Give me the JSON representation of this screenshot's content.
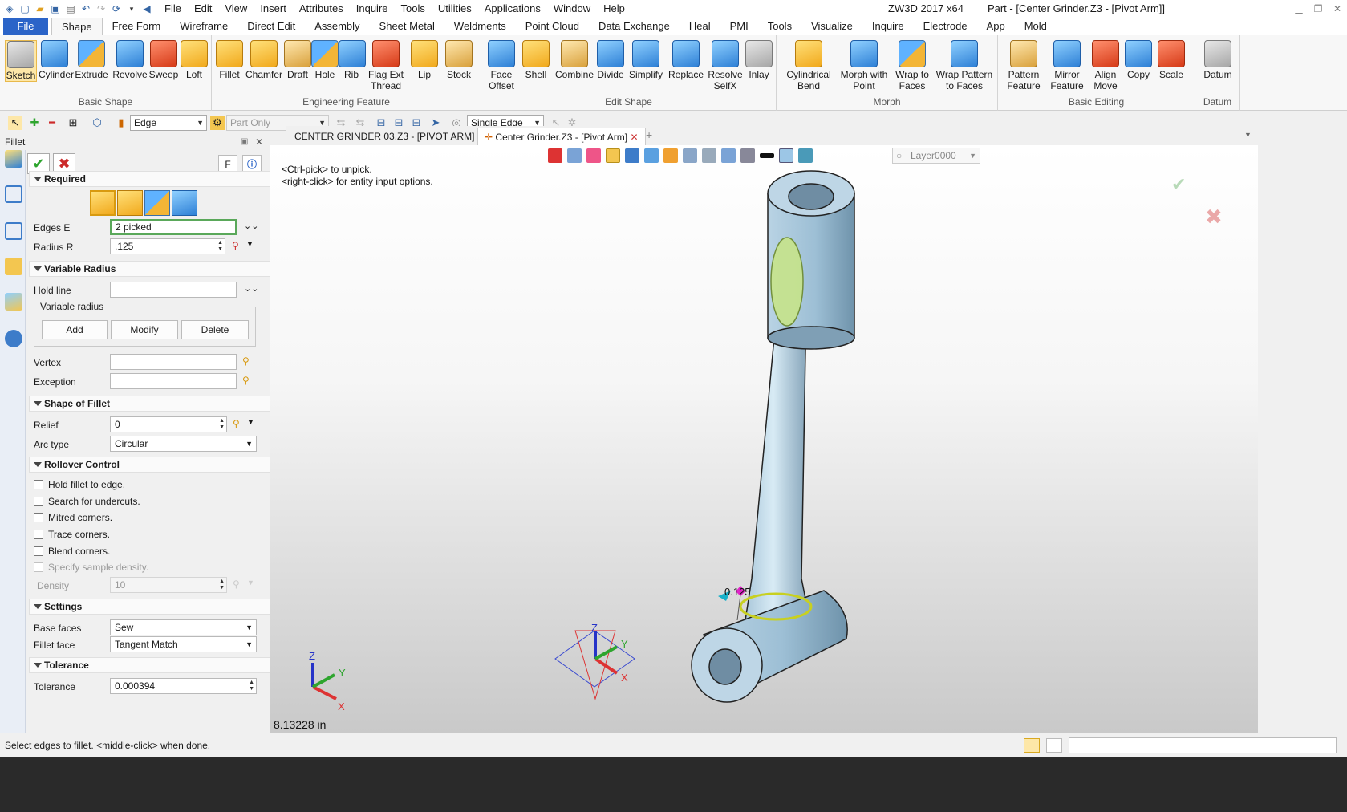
{
  "titlebar": {
    "menu": [
      "File",
      "Edit",
      "View",
      "Insert",
      "Attributes",
      "Inquire",
      "Tools",
      "Utilities",
      "Applications",
      "Window",
      "Help"
    ],
    "app_name": "ZW3D 2017  x64",
    "doc_title": "Part - [Center Grinder.Z3 - [Pivot Arm]]"
  },
  "ribbon_tabs": [
    "File",
    "Shape",
    "Free Form",
    "Wireframe",
    "Direct Edit",
    "Assembly",
    "Sheet Metal",
    "Weldments",
    "Point Cloud",
    "Data Exchange",
    "Heal",
    "PMI",
    "Tools",
    "Visualize",
    "Inquire",
    "Electrode",
    "App",
    "Mold"
  ],
  "ribbon_groups": {
    "basic_shape": {
      "label": "Basic Shape",
      "buttons": [
        "Sketch",
        "Cylinder",
        "Extrude",
        "Revolve",
        "Sweep",
        "Loft"
      ]
    },
    "engineering": {
      "label": "Engineering Feature",
      "buttons": [
        "Fillet",
        "Chamfer",
        "Draft",
        "Hole",
        "Rib",
        "Flag Ext\nThread",
        "Lip",
        "Stock"
      ]
    },
    "edit_shape": {
      "label": "Edit Shape",
      "buttons": [
        "Face\nOffset",
        "Shell",
        "Combine",
        "Divide",
        "Simplify",
        "Replace",
        "Resolve\nSelfX",
        "Inlay"
      ]
    },
    "morph": {
      "label": "Morph",
      "buttons": [
        "Cylindrical\nBend",
        "Morph with\nPoint",
        "Wrap to\nFaces",
        "Wrap Pattern\nto Faces"
      ]
    },
    "basic_editing": {
      "label": "Basic Editing",
      "buttons": [
        "Pattern\nFeature",
        "Mirror\nFeature",
        "Align\nMove",
        "Copy",
        "Scale"
      ]
    },
    "datum": {
      "label": "Datum",
      "buttons": [
        "Datum"
      ]
    }
  },
  "toolbar2": {
    "filter": "Edge",
    "scope": "Part Only",
    "pick_mode": "Single Edge"
  },
  "panel": {
    "title": "Fillet",
    "f_button": "F",
    "sections": {
      "required": "Required",
      "variable_radius": "Variable Radius",
      "shape": "Shape of Fillet",
      "rollover": "Rollover Control",
      "settings": "Settings",
      "tolerance": "Tolerance"
    },
    "edges_label": "Edges E",
    "edges_value": "2 picked",
    "radius_label": "Radius R",
    "radius_value": ".125",
    "hold_line_label": "Hold line",
    "variable_radius_group": "Variable radius",
    "add": "Add",
    "modify": "Modify",
    "delete": "Delete",
    "vertex_label": "Vertex",
    "exception_label": "Exception",
    "relief_label": "Relief",
    "relief_value": "0",
    "arc_type_label": "Arc type",
    "arc_type_value": "Circular",
    "rollover_options": [
      "Hold fillet to edge.",
      "Search for undercuts.",
      "Mitred corners.",
      "Trace corners.",
      "Blend corners."
    ],
    "sample_density": "Specify sample density.",
    "density_label": "Density",
    "density_value": "10",
    "base_faces_label": "Base faces",
    "base_faces_value": "Sew",
    "fillet_face_label": "Fillet face",
    "fillet_face_value": "Tangent Match",
    "tolerance_label": "Tolerance",
    "tolerance_value": "0.000394"
  },
  "doc_tabs": [
    "CENTER GRINDER 03.Z3 - [PIVOT ARM]",
    "Center Grinder.Z3 - [Pivot Arm]"
  ],
  "viewport": {
    "hint1": "<Ctrl-pick> to unpick.",
    "hint2": "<right-click> for entity input options.",
    "layer": "Layer0000",
    "radius_tag": "0.125",
    "scale_readout": "8.13228 in",
    "axis_labels": {
      "x": "X",
      "y": "Y",
      "z": "Z"
    }
  },
  "status": {
    "text": "Select edges to fillet.  <middle-click> when done."
  },
  "colors": {
    "file_tab": "#2b64c8",
    "part_body": "#a9c7d9",
    "fillet_highlight": "#b9e05a",
    "accept": "#2ea52e",
    "cancel": "#cc2a2a"
  }
}
